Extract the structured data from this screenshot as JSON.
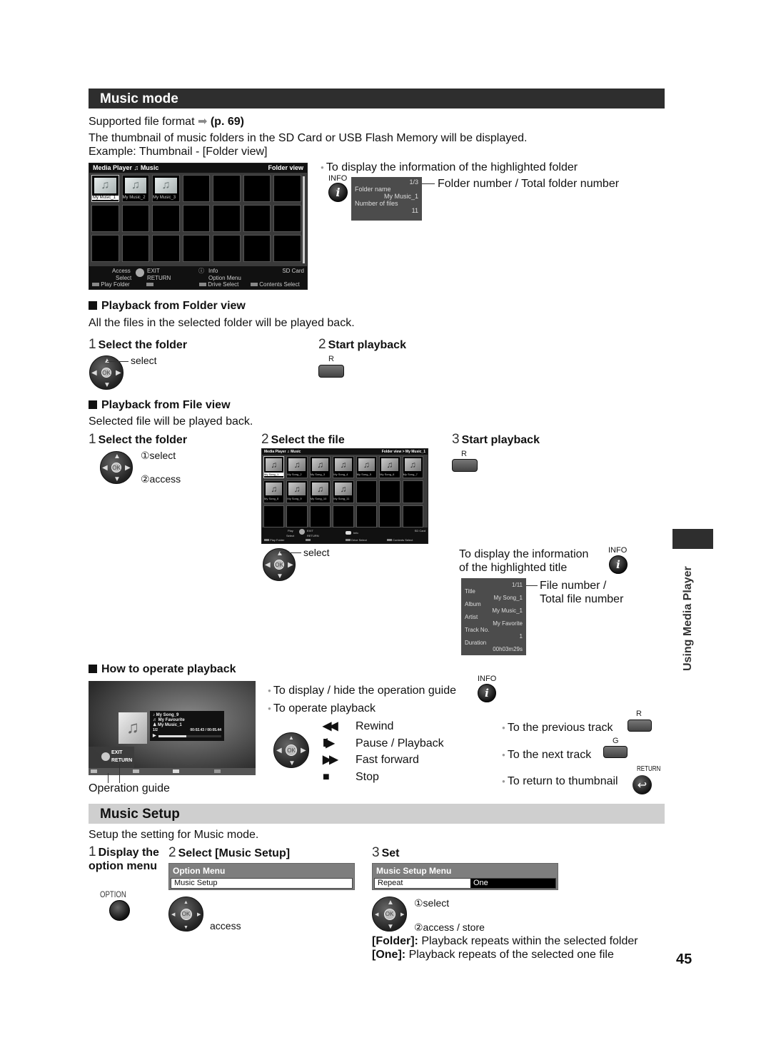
{
  "music_mode": {
    "title": "Music mode",
    "supported_format": "Supported file format",
    "supported_format_ref": "(p. 69)",
    "intro": "The thumbnail of music folders in the SD Card or USB Flash Memory will be displayed.",
    "example": "Example: Thumbnail - [Folder view]",
    "folder_screen": {
      "app": "Media Player",
      "mode": "Music",
      "view": "Folder view",
      "folders": [
        "My Music_1",
        "My Music_2",
        "My Music_3"
      ],
      "footer": {
        "access": "Access",
        "select": "Select",
        "exit": "EXIT",
        "return": "RETURN",
        "info": "Info",
        "option_menu": "Option Menu",
        "sd_card": "SD Card",
        "play_folder": "Play Folder",
        "drive_select": "Drive Select",
        "contents_select": "Contents Select"
      }
    },
    "folder_info": {
      "caption": "To display the information of the highlighted folder",
      "info_label": "INFO",
      "counter": "1/3",
      "counter_note": "Folder number / Total folder number",
      "folder_name_label": "Folder name",
      "folder_name": "My Music_1",
      "num_files_label": "Number of files",
      "num_files": "11"
    },
    "folder_playback": {
      "heading": "Playback from Folder view",
      "desc": "All the files in the selected folder will be played back.",
      "step1_num": "1",
      "step1": "Select the folder",
      "step1_select": "select",
      "step2_num": "2",
      "step2": "Start playback",
      "button_r": "R"
    },
    "file_playback": {
      "heading": "Playback from File view",
      "desc": "Selected file will be played back.",
      "step1_num": "1",
      "step1": "Select the folder",
      "step1_select": "①select",
      "step1_access": "②access",
      "step2_num": "2",
      "step2": "Select the file",
      "step2_select": "select",
      "step3_num": "3",
      "step3": "Start playback",
      "button_r": "R",
      "file_screen": {
        "app": "Media Player",
        "mode": "Music",
        "view": "Folder view > My Music_1",
        "files": [
          "My Song_1",
          "My Song_2",
          "My Song_3",
          "My Song_4",
          "My Song_5",
          "My Song_6",
          "My Song_7",
          "My Song_8",
          "My Song_9",
          "My Song_10",
          "My Song_11"
        ],
        "footer": {
          "play": "Play",
          "select": "Select",
          "exit": "EXIT",
          "return": "RETURN",
          "info": "Info",
          "sd_card": "SD Card",
          "play_folder": "Play Folder",
          "drive_select": "Drive Select",
          "contents_select": "Contents Select"
        }
      },
      "title_info": {
        "caption_line1": "To display the information",
        "caption_line2": "of the highlighted title",
        "info_label": "INFO",
        "counter": "1/11",
        "counter_note_line1": "File number /",
        "counter_note_line2": "Total file number",
        "fields": [
          {
            "label": "Title",
            "value": "My Song_1"
          },
          {
            "label": "Album",
            "value": "My Music_1"
          },
          {
            "label": "Artist",
            "value": "My Favorite"
          },
          {
            "label": "Track No.",
            "value": "1"
          },
          {
            "label": "Duration",
            "value": "00h03m29s"
          }
        ]
      }
    },
    "operate": {
      "heading": "How to operate playback",
      "player": {
        "song": "My Song_9",
        "artist": "My Favourite",
        "album": "My Music_1",
        "track": "1/2",
        "time": "00:02.43 / 00:05.44",
        "progress": 0.45,
        "exit": "EXIT",
        "return": "RETURN"
      },
      "operation_guide": "Operation guide",
      "toggle_guide": "To display / hide the operation guide",
      "info_label": "INFO",
      "operate_label": "To operate playback",
      "controls": [
        {
          "symbol": "◀◀",
          "label": "Rewind"
        },
        {
          "symbol": "II/▶",
          "label": "Pause / Playback"
        },
        {
          "symbol": "▶▶",
          "label": "Fast forward"
        },
        {
          "symbol": "■",
          "label": "Stop"
        }
      ],
      "prev_track": "To the previous track",
      "prev_key": "R",
      "next_track": "To the next track",
      "next_key": "G",
      "return_thumb": "To return to thumbnail",
      "return_key": "RETURN"
    }
  },
  "music_setup": {
    "title": "Music Setup",
    "desc": "Setup the setting for Music mode.",
    "step1_num": "1",
    "step1": "Display the option menu",
    "option_label": "OPTION",
    "step2_num": "2",
    "step2": "Select [Music Setup]",
    "option_menu_title": "Option Menu",
    "option_menu_item": "Music Setup",
    "access": "access",
    "step3_num": "3",
    "step3": "Set",
    "setup_menu_title": "Music Setup Menu",
    "setup_item": "Repeat",
    "setup_value": "One",
    "select": "①select",
    "access_store": "②access / store",
    "folder_key": "[Folder]:",
    "folder_desc": "Playback repeats within the selected folder",
    "one_key": "[One]:",
    "one_desc": "Playback repeats of the selected one file"
  },
  "side_tab": "Using Media Player",
  "page_number": "45"
}
